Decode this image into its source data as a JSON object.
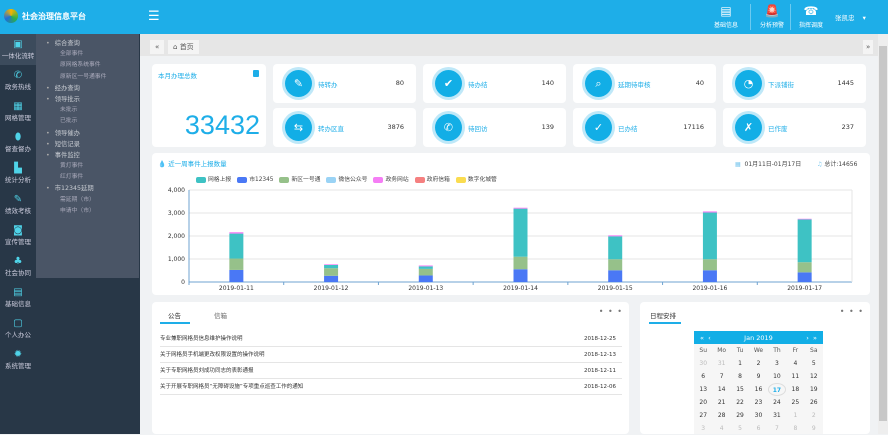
{
  "app": {
    "title": "社会治理信息平台",
    "user": "张凯忠"
  },
  "topnav": [
    {
      "label": "基础信息",
      "icon": "database-icon"
    },
    {
      "label": "分析预警",
      "icon": "alarm-icon"
    },
    {
      "label": "指挥调度",
      "icon": "headset-icon"
    }
  ],
  "sidebar": {
    "items": [
      {
        "label": "一体化流转",
        "icon": "monitor-icon",
        "active": true
      },
      {
        "label": "政务热线",
        "icon": "phone-icon"
      },
      {
        "label": "网格管理",
        "icon": "grid-icon"
      },
      {
        "label": "督查督办",
        "icon": "shield-icon"
      },
      {
        "label": "统计分析",
        "icon": "bar-chart-icon"
      },
      {
        "label": "绩效考核",
        "icon": "edit-icon"
      },
      {
        "label": "宣传管理",
        "icon": "tv-icon"
      },
      {
        "label": "社会协同",
        "icon": "org-icon"
      },
      {
        "label": "基础信息",
        "icon": "database-icon"
      },
      {
        "label": "个人办公",
        "icon": "desktop-icon"
      },
      {
        "label": "系统管理",
        "icon": "gear-icon"
      }
    ],
    "submenu": [
      {
        "label": "综合查询",
        "children": [
          "全部事件",
          "原网格系统事件",
          "原新区一号通事件"
        ]
      },
      {
        "label": "经办查询",
        "children": []
      },
      {
        "label": "领导批示",
        "children": [
          "未批示",
          "已批示"
        ]
      },
      {
        "label": "领导催办",
        "children": []
      },
      {
        "label": "短信记录",
        "children": []
      },
      {
        "label": "事件监控",
        "children": [
          "黄灯事件",
          "红灯事件"
        ]
      },
      {
        "label": "市12345延期",
        "children": [
          "需延期（市）",
          "申请中（市）"
        ]
      }
    ]
  },
  "tabs": {
    "home": "首页"
  },
  "summary": {
    "label": "本月办理总数",
    "value": "33432"
  },
  "stats": [
    {
      "label": "待转办",
      "value": "80",
      "icon": "form-icon"
    },
    {
      "label": "待办结",
      "value": "140",
      "icon": "check-doc-icon"
    },
    {
      "label": "延期待审核",
      "value": "40",
      "icon": "search-doc-icon"
    },
    {
      "label": "下派铺街",
      "value": "1445",
      "icon": "timer-icon"
    },
    {
      "label": "转办区直",
      "value": "3876",
      "icon": "transfer-icon"
    },
    {
      "label": "待回访",
      "value": "139",
      "icon": "phone-callback-icon"
    },
    {
      "label": "已办结",
      "value": "17116",
      "icon": "clipboard-check-icon"
    },
    {
      "label": "已作废",
      "value": "237",
      "icon": "void-doc-icon"
    }
  ],
  "chart_panel": {
    "title": "近一周事件上报数量",
    "date_range": "01月11日-01月17日",
    "total": "总计:14656"
  },
  "chart_data": {
    "type": "bar",
    "stacked": true,
    "categories": [
      "2019-01-11",
      "2019-01-12",
      "2019-01-13",
      "2019-01-14",
      "2019-01-15",
      "2019-01-16",
      "2019-01-17"
    ],
    "ylim": [
      0,
      4000
    ],
    "yticks": [
      "0",
      "1,000",
      "2,000",
      "3,000",
      "4,000"
    ],
    "grid": true,
    "legend": "top",
    "series": [
      {
        "name": "市12345",
        "color": "#4a78f5",
        "values": [
          525,
          270,
          285,
          555,
          510,
          510,
          420
        ]
      },
      {
        "name": "新区一号通",
        "color": "#96c18a",
        "values": [
          495,
          330,
          285,
          545,
          480,
          480,
          440
        ]
      },
      {
        "name": "微信公众号",
        "color": "#9ad3f5",
        "values": [
          0,
          0,
          0,
          0,
          0,
          0,
          0
        ]
      },
      {
        "name": "网格上报",
        "color": "#3ec2c4",
        "values": [
          1085,
          140,
          110,
          2090,
          995,
          2030,
          1860
        ]
      },
      {
        "name": "政务网站",
        "color": "#f57ef5",
        "values": [
          60,
          30,
          40,
          40,
          45,
          50,
          30
        ]
      },
      {
        "name": "政府信箱",
        "color": "#f58080",
        "values": [
          0,
          0,
          0,
          0,
          0,
          0,
          0
        ]
      },
      {
        "name": "数字化城管",
        "color": "#fadc50",
        "values": [
          0,
          0,
          0,
          0,
          0,
          0,
          0
        ]
      }
    ],
    "legend_order": [
      "网格上报",
      "市12345",
      "新区一号通",
      "微信公众号",
      "政务网站",
      "政府信箱",
      "数字化城管"
    ]
  },
  "notices": {
    "tabs": [
      "公告",
      "信箱"
    ],
    "more": "• • •",
    "items": [
      {
        "title": "专业兼职网格员信息维护操作说明",
        "date": "2018-12-25"
      },
      {
        "title": "关于网格员手机端更改权限设置的操作说明",
        "date": "2018-12-13"
      },
      {
        "title": "关于专职网格员刘成功同志的表彰通报",
        "date": "2018-12-11"
      },
      {
        "title": "关于开展专职网格员“无障碍设施”专项重点巡查工作的通知",
        "date": "2018-12-06"
      }
    ]
  },
  "schedule": {
    "title": "日程安排",
    "more": "• • •",
    "month": "Jan  2019",
    "weekdays": [
      "Su",
      "Mo",
      "Tu",
      "We",
      "Th",
      "Fr",
      "Sa"
    ],
    "days": [
      "30",
      "31",
      "1",
      "2",
      "3",
      "4",
      "5",
      "6",
      "7",
      "8",
      "9",
      "10",
      "11",
      "12",
      "13",
      "14",
      "15",
      "16",
      "17",
      "18",
      "19",
      "20",
      "21",
      "22",
      "23",
      "24",
      "25",
      "26",
      "27",
      "28",
      "29",
      "30",
      "31",
      "1",
      "2",
      "3",
      "4",
      "5",
      "6",
      "7",
      "8",
      "9"
    ],
    "today": "17"
  }
}
